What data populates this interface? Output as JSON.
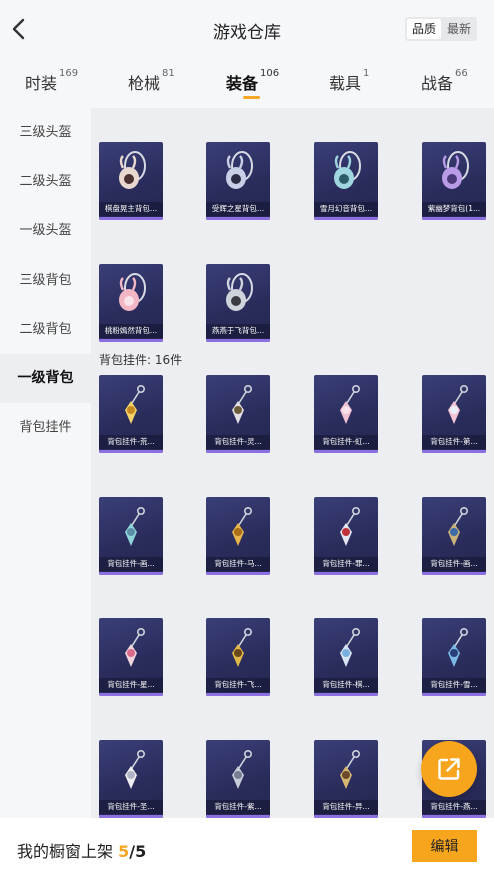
{
  "header": {
    "back_icon": "chevron-left-icon",
    "title": "游戏仓库",
    "sort": {
      "options": [
        "品质",
        "最新"
      ],
      "selected": "品质"
    }
  },
  "tabs": [
    {
      "label": "时装",
      "count": "169"
    },
    {
      "label": "枪械",
      "count": "81"
    },
    {
      "label": "装备",
      "count": "106",
      "active": true
    },
    {
      "label": "载具",
      "count": "1"
    },
    {
      "label": "战备",
      "count": "66"
    }
  ],
  "sidebar": {
    "items": [
      {
        "label": "三级头盔"
      },
      {
        "label": "二级头盔"
      },
      {
        "label": "一级头盔"
      },
      {
        "label": "三级背包"
      },
      {
        "label": "二级背包"
      },
      {
        "label": "一级背包",
        "active": true
      },
      {
        "label": "背包挂件"
      }
    ]
  },
  "backpacks": [
    {
      "label": "棋盘晃主背包...",
      "icon": "heart-backpack-icon"
    },
    {
      "label": "受辉之星背包...",
      "icon": "rabbit-backpack-icon"
    },
    {
      "label": "雪月幻音背包...",
      "icon": "orb-backpack-icon"
    },
    {
      "label": "紫幽梦背包(1...",
      "icon": "purple-orb-backpack-icon"
    },
    {
      "label": "桃粉嫣然背包...",
      "icon": "pink-bunny-backpack-icon"
    },
    {
      "label": "燕燕于飞背包...",
      "icon": "eye-backpack-icon"
    }
  ],
  "charms_section": {
    "label": "背包挂件: 16件"
  },
  "charms": [
    {
      "label": "背包挂件-荒...",
      "icon": "gold-star-charm-icon"
    },
    {
      "label": "背包挂件-灵...",
      "icon": "dagger-charm-icon"
    },
    {
      "label": "背包挂件-虹...",
      "icon": "pink-pig-charm-icon"
    },
    {
      "label": "背包挂件-第...",
      "icon": "pink-heart-charm-icon"
    },
    {
      "label": "背包挂件-画...",
      "icon": "teal-wand-charm-icon"
    },
    {
      "label": "背包挂件-马...",
      "icon": "gold-horse-charm-icon"
    },
    {
      "label": "背包挂件-罪...",
      "icon": "winged-heart-charm-icon"
    },
    {
      "label": "背包挂件-画...",
      "icon": "staff-charm-icon"
    },
    {
      "label": "背包挂件-星...",
      "icon": "heart-chime-charm-icon"
    },
    {
      "label": "背包挂件-飞...",
      "icon": "gold-cross-charm-icon"
    },
    {
      "label": "背包挂件-棋...",
      "icon": "chess-knight-charm-icon"
    },
    {
      "label": "背包挂件-雪...",
      "icon": "snow-bow-charm-icon"
    },
    {
      "label": "背包挂件-圣...",
      "icon": "crystal-charm-icon"
    },
    {
      "label": "背包挂件-紫...",
      "icon": "bell-charm-icon"
    },
    {
      "label": "背包挂件-异...",
      "icon": "silver-wings-charm-icon"
    },
    {
      "label": "背包挂件-燕...",
      "icon": "swallow-charm-icon"
    }
  ],
  "fab": {
    "icon": "share-external-icon"
  },
  "bottom_bar": {
    "text": "我的橱窗上架",
    "count": "5",
    "total": "/5",
    "edit_label": "编辑"
  },
  "colors": {
    "accent": "#f7a51c",
    "card_bg": "#2a2d5c",
    "card_bar": "#8c6fe0"
  }
}
